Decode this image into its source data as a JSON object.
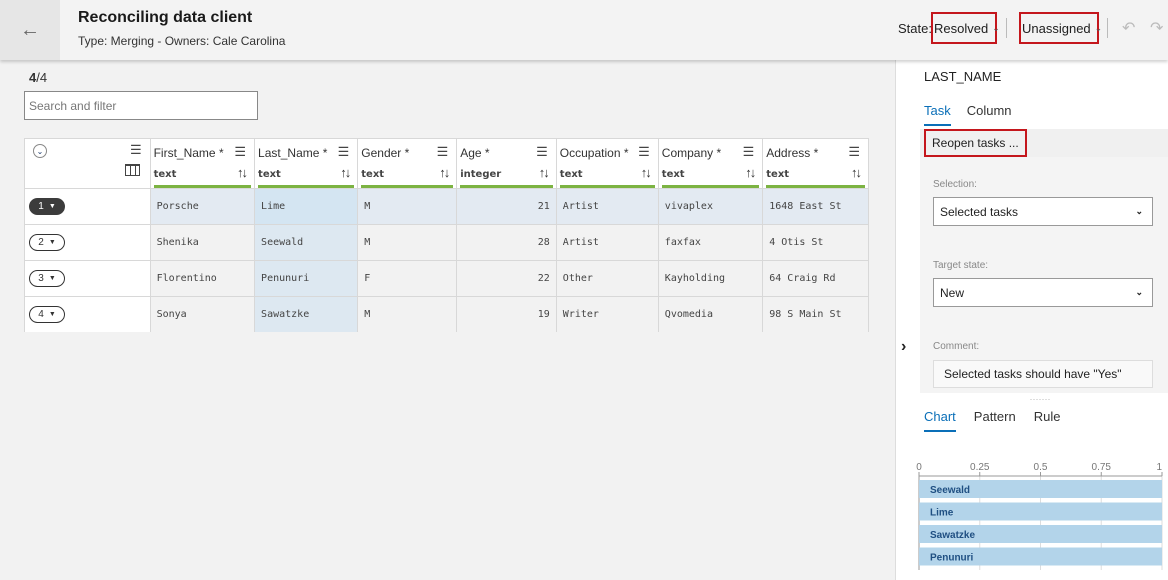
{
  "header": {
    "back_icon": "arrow-left-icon",
    "title": "Reconciling data client",
    "subtitle": "Type: Merging - Owners: Cale Carolina",
    "state_label": "State:",
    "state_value": "Resolved",
    "assignee_value": "Unassigned",
    "undo_icon": "undo-icon",
    "redo_icon": "redo-icon"
  },
  "list": {
    "count_current": "4",
    "count_total": "/4",
    "search_placeholder": "Search and filter"
  },
  "grid": {
    "columns": [
      {
        "name": "First_Name *",
        "type": "text"
      },
      {
        "name": "Last_Name *",
        "type": "text"
      },
      {
        "name": "Gender *",
        "type": "text"
      },
      {
        "name": "Age *",
        "type": "integer"
      },
      {
        "name": "Occupation *",
        "type": "text"
      },
      {
        "name": "Company *",
        "type": "text"
      },
      {
        "name": "Address *",
        "type": "text"
      }
    ],
    "rows": [
      {
        "num": "1",
        "cells": [
          "Porsche",
          "Lime",
          "M",
          "21",
          "Artist",
          "vivaplex",
          "1648 East St"
        ]
      },
      {
        "num": "2",
        "cells": [
          "Shenika",
          "Seewald",
          "M",
          "28",
          "Artist",
          "faxfax",
          "4 Otis St"
        ]
      },
      {
        "num": "3",
        "cells": [
          "Florentino",
          "Penunuri",
          "F",
          "22",
          "Other",
          "Kayholding",
          "64 Craig Rd"
        ]
      },
      {
        "num": "4",
        "cells": [
          "Sonya",
          "Sawatzke",
          "M",
          "19",
          "Writer",
          "Qvomedia",
          "98 S Main St"
        ]
      }
    ]
  },
  "panel": {
    "title": "LAST_NAME",
    "tabs": [
      "Task",
      "Column"
    ],
    "active_tab": "Task",
    "reopen_label": "Reopen tasks ...",
    "selection_label": "Selection:",
    "selection_value": "Selected tasks",
    "target_label": "Target state:",
    "target_value": "New",
    "comment_label": "Comment:",
    "comment_value": "Selected tasks should have \"Yes\"",
    "grip": "⠀⠀⠀⠀⠀⠀⠀",
    "tabs2": [
      "Chart",
      "Pattern",
      "Rule"
    ],
    "active_tab2": "Chart"
  },
  "chart_data": {
    "type": "bar",
    "orientation": "horizontal",
    "categories": [
      "Seewald",
      "Lime",
      "Sawatzke",
      "Penunuri"
    ],
    "values": [
      1,
      1,
      1,
      1
    ],
    "xlim": [
      0,
      1
    ],
    "xticks": [
      "0",
      "0.25",
      "0.5",
      "0.75",
      "1"
    ],
    "grid": true,
    "bar_color": "#b3d4ea",
    "label_color": "#1f4f82"
  }
}
